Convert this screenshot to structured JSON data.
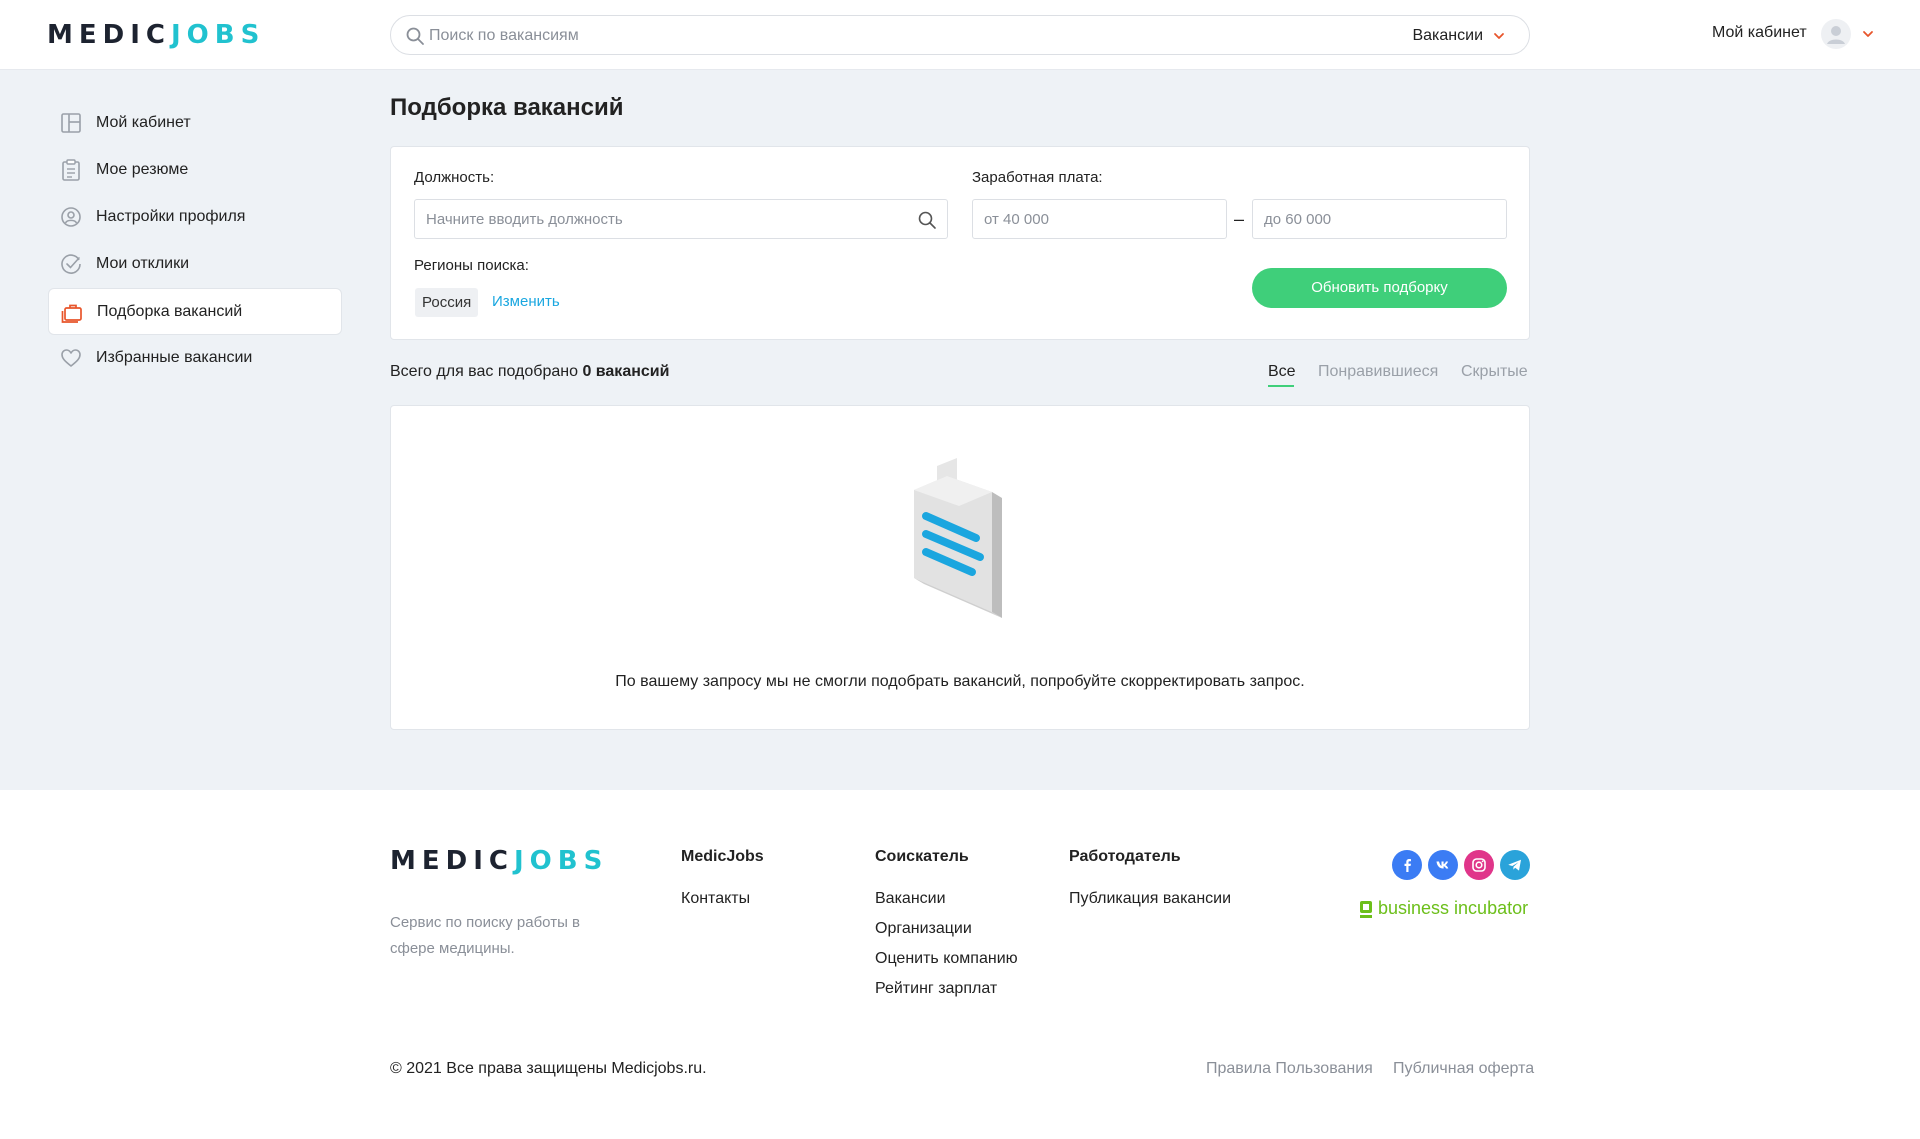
{
  "header": {
    "logo_part1": "MEDIC",
    "logo_part2": "JOBS",
    "search_placeholder": "Поиск по вакансиям",
    "search_category": "Вакансии",
    "cabinet_label": "Мой кабинет"
  },
  "sidebar": {
    "items": [
      {
        "label": "Мой кабинет",
        "icon": "dashboard-icon"
      },
      {
        "label": "Мое резюме",
        "icon": "clipboard-icon"
      },
      {
        "label": "Настройки профиля",
        "icon": "user-circle-icon"
      },
      {
        "label": "Мои отклики",
        "icon": "check-circle-icon"
      },
      {
        "label": "Подборка вакансий",
        "icon": "briefcase-icon",
        "active": true
      },
      {
        "label": "Избранные вакансии",
        "icon": "heart-icon"
      }
    ]
  },
  "main": {
    "title": "Подборка вакансий",
    "filter": {
      "position_label": "Должность:",
      "position_placeholder": "Начните вводить должность",
      "salary_label": "Заработная плата:",
      "salary_from_placeholder": "от 40 000",
      "salary_to_placeholder": "до 60 000",
      "salary_dash": "–",
      "regions_label": "Регионы поиска:",
      "region_chip": "Россия",
      "change_link": "Изменить",
      "update_button": "Обновить подборку"
    },
    "summary": {
      "prefix": "Всего для вас подобрано ",
      "count": "0 вакансий"
    },
    "tabs": [
      {
        "label": "Все",
        "active": true
      },
      {
        "label": "Понравившиеся",
        "active": false
      },
      {
        "label": "Скрытые",
        "active": false
      }
    ],
    "empty_message": "По вашему запросу мы не смогли подобрать вакансий, попробуйте скорректировать запрос."
  },
  "footer": {
    "logo_part1": "MEDIC",
    "logo_part2": "JOBS",
    "description": "Сервис по поиску работы в сфере медицины.",
    "columns": [
      {
        "title": "MedicJobs",
        "links": [
          "Контакты"
        ]
      },
      {
        "title": "Соискатель",
        "links": [
          "Вакансии",
          "Организации",
          "Оценить компанию",
          "Рейтинг зарплат"
        ]
      },
      {
        "title": "Работодатель",
        "links": [
          "Публикация вакансии"
        ]
      }
    ],
    "social": [
      {
        "icon": "facebook-icon",
        "color": "#3b7cf4"
      },
      {
        "icon": "vk-icon",
        "color": "#3b7cf4"
      },
      {
        "icon": "instagram-icon",
        "color": "#e0358a"
      },
      {
        "icon": "telegram-icon",
        "color": "#2aa3da"
      }
    ],
    "incubator_label": "business incubator",
    "copyright": "© 2021 Все права защищены Medicjobs.ru.",
    "legal_links": [
      "Правила Пользования",
      "Публичная оферта"
    ]
  },
  "colors": {
    "accent_green": "#3fcf7a",
    "logo_teal": "#21c2cf",
    "link_blue": "#1aa7e0",
    "active_orange": "#e8552b"
  }
}
